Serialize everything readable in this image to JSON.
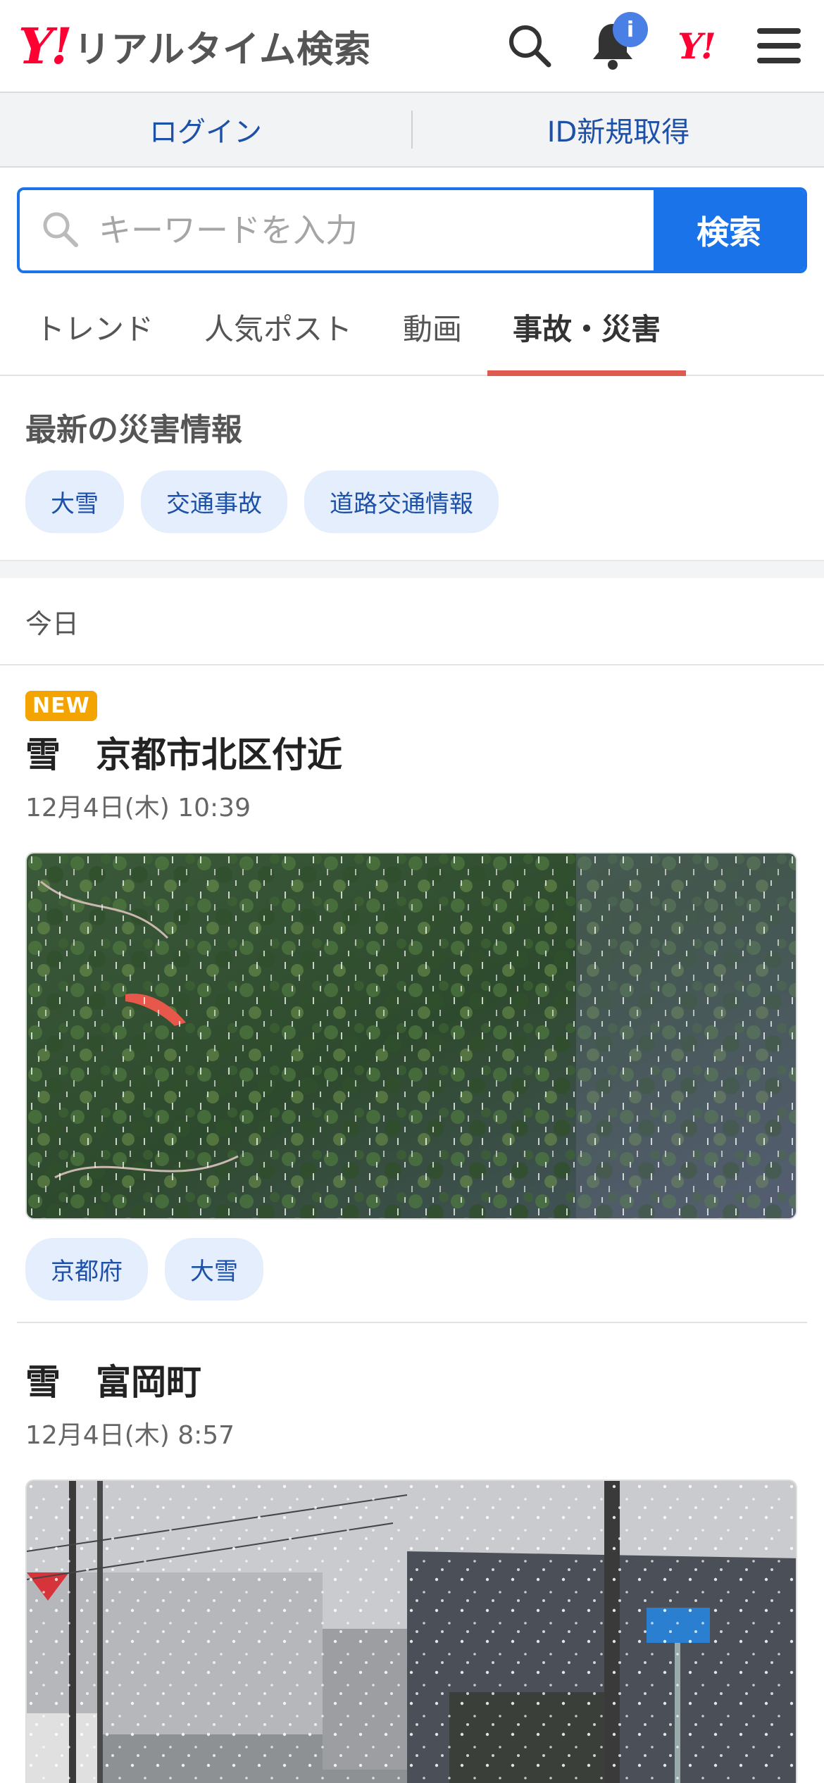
{
  "header": {
    "logo_mark": "Y!",
    "logo_text": "リアルタイム検索",
    "notification_badge": "i",
    "yahoo_mark": "Y!"
  },
  "login_bar": {
    "login": "ログイン",
    "register": "ID新規取得"
  },
  "search": {
    "placeholder": "キーワードを入力",
    "button": "検索"
  },
  "tabs": [
    {
      "label": "トレンド"
    },
    {
      "label": "人気ポスト"
    },
    {
      "label": "動画"
    },
    {
      "label": "事故・災害",
      "active": true
    }
  ],
  "disaster_info": {
    "title": "最新の災害情報",
    "chips": [
      "大雪",
      "交通事故",
      "道路交通情報"
    ]
  },
  "date_heading": "今日",
  "articles": [
    {
      "badge": "NEW",
      "title": "雪　京都市北区付近",
      "time": "12月4日(木) 10:39",
      "tags": [
        "京都府",
        "大雪"
      ]
    },
    {
      "title": "雪　富岡町",
      "time": "12月4日(木) 8:57"
    }
  ],
  "colors": {
    "accent": "#1a73e8",
    "brand": "#ff0033",
    "active_tab_underline": "#e05a4f",
    "new_badge": "#f4a400",
    "chip_bg": "#e4eefc",
    "link": "#1d50a8"
  }
}
